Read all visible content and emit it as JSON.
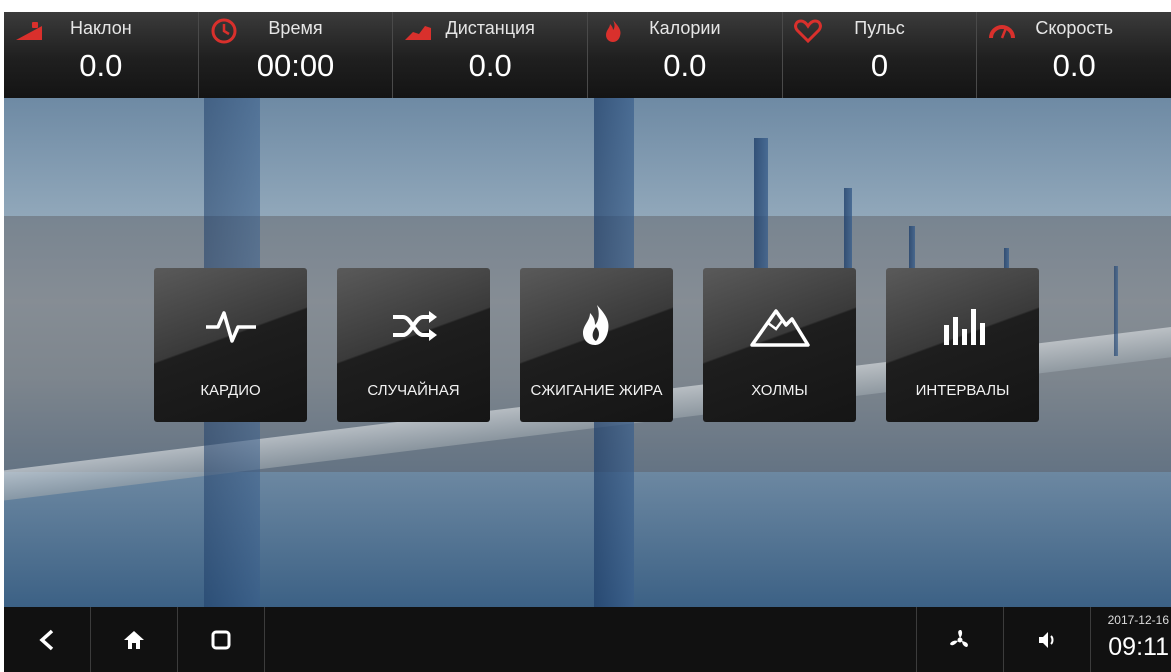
{
  "metrics": [
    {
      "label": "Наклон",
      "value": "0.0",
      "icon": "incline-icon"
    },
    {
      "label": "Время",
      "value": "00:00",
      "icon": "clock-icon"
    },
    {
      "label": "Дистанция",
      "value": "0.0",
      "icon": "distance-icon"
    },
    {
      "label": "Калории",
      "value": "0.0",
      "icon": "flame-icon"
    },
    {
      "label": "Пульс",
      "value": "0",
      "icon": "heart-icon"
    },
    {
      "label": "Скорость",
      "value": "0.0",
      "icon": "speedometer-icon"
    }
  ],
  "programs": [
    {
      "label": "КАРДИО",
      "icon": "heartbeat-icon"
    },
    {
      "label": "СЛУЧАЙНАЯ",
      "icon": "shuffle-icon"
    },
    {
      "label": "СЖИГАНИЕ ЖИРА",
      "icon": "flame-icon"
    },
    {
      "label": "ХОЛМЫ",
      "icon": "mountain-icon"
    },
    {
      "label": "ИНТЕРВАЛЫ",
      "icon": "bars-icon"
    }
  ],
  "navbar": {
    "date": "2017-12-16",
    "time": "09:11"
  },
  "colors": {
    "accent": "#d9302c",
    "bar": "#1a1a1a"
  }
}
